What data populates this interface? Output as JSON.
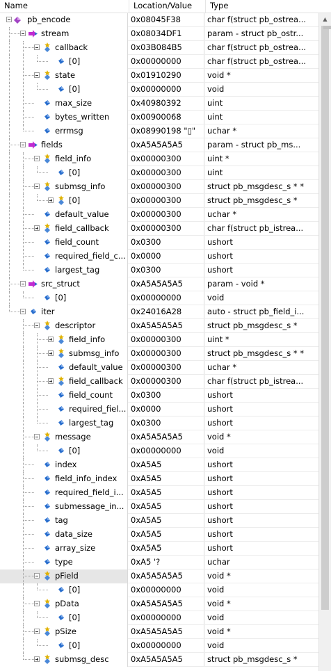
{
  "header": {
    "name": "Name",
    "location": "Location/Value",
    "type": "Type"
  },
  "rows": [
    {
      "d": 0,
      "icon": "function-icon",
      "tg": "minus",
      "name": "pb_encode",
      "value": "0x08045F38",
      "type": "char f(struct pb_ostrea..."
    },
    {
      "d": 1,
      "icon": "param-icon",
      "tg": "minus",
      "name": "stream",
      "value": "0x08034DF1",
      "type": "param - struct pb_ostr..."
    },
    {
      "d": 2,
      "icon": "pointer-icon",
      "tg": "minus",
      "name": "callback",
      "value": "0x03B084B5",
      "type": "char f(struct pb_ostrea..."
    },
    {
      "d": 3,
      "icon": "variable-icon",
      "name": "[0]",
      "value": "0x00000000",
      "type": "char f(struct pb_ostrea..."
    },
    {
      "d": 2,
      "icon": "pointer-icon",
      "tg": "minus",
      "name": "state",
      "value": "0x01910290",
      "type": "void *"
    },
    {
      "d": 3,
      "icon": "variable-icon",
      "name": "[0]",
      "value": "0x00000000",
      "type": "void"
    },
    {
      "d": 2,
      "icon": "variable-icon",
      "name": "max_size",
      "value": "0x40980392",
      "type": "uint"
    },
    {
      "d": 2,
      "icon": "variable-icon",
      "name": "bytes_written",
      "value": "0x00900068",
      "type": "uint"
    },
    {
      "d": 2,
      "icon": "variable-icon",
      "name": "errmsg",
      "value": "0x08990198 \"▯\"",
      "type": "uchar *"
    },
    {
      "d": 1,
      "icon": "param-icon",
      "tg": "minus",
      "name": "fields",
      "value": "0xA5A5A5A5",
      "type": "param - struct pb_ms..."
    },
    {
      "d": 2,
      "icon": "pointer-icon",
      "tg": "minus",
      "name": "field_info",
      "value": "0x00000300",
      "type": "uint *"
    },
    {
      "d": 3,
      "icon": "variable-icon",
      "name": "[0]",
      "value": "0x00000300",
      "type": "uint"
    },
    {
      "d": 2,
      "icon": "pointer-icon",
      "tg": "minus",
      "name": "submsg_info",
      "value": "0x00000300",
      "type": "struct pb_msgdesc_s * *"
    },
    {
      "d": 3,
      "icon": "pointer-icon",
      "tg": "plus",
      "name": "[0]",
      "value": "0x00000300",
      "type": "struct pb_msgdesc_s *"
    },
    {
      "d": 2,
      "icon": "variable-icon",
      "name": "default_value",
      "value": "0x00000300",
      "type": "uchar *"
    },
    {
      "d": 2,
      "icon": "pointer-icon",
      "tg": "plus",
      "name": "field_callback",
      "value": "0x00000300",
      "type": "char f(struct pb_istrea..."
    },
    {
      "d": 2,
      "icon": "variable-icon",
      "name": "field_count",
      "value": "0x0300",
      "type": "ushort"
    },
    {
      "d": 2,
      "icon": "variable-icon",
      "name": "required_field_c...",
      "value": "0x0000",
      "type": "ushort"
    },
    {
      "d": 2,
      "icon": "variable-icon",
      "name": "largest_tag",
      "value": "0x0300",
      "type": "ushort"
    },
    {
      "d": 1,
      "icon": "param-icon",
      "tg": "minus",
      "name": "src_struct",
      "value": "0xA5A5A5A5",
      "type": "param - void *"
    },
    {
      "d": 2,
      "icon": "variable-icon",
      "name": "[0]",
      "value": "0x00000000",
      "type": "void"
    },
    {
      "d": 1,
      "icon": "variable-icon",
      "tg": "minus",
      "name": "iter",
      "value": "0x24016A28",
      "type": "auto - struct pb_field_i..."
    },
    {
      "d": 2,
      "icon": "pointer-icon",
      "tg": "minus",
      "name": "descriptor",
      "value": "0xA5A5A5A5",
      "type": "struct pb_msgdesc_s *"
    },
    {
      "d": 3,
      "icon": "pointer-icon",
      "tg": "plus",
      "name": "field_info",
      "value": "0x00000300",
      "type": "uint *"
    },
    {
      "d": 3,
      "icon": "pointer-icon",
      "tg": "plus",
      "name": "submsg_info",
      "value": "0x00000300",
      "type": "struct pb_msgdesc_s * *"
    },
    {
      "d": 3,
      "icon": "variable-icon",
      "name": "default_value",
      "value": "0x00000300",
      "type": "uchar *"
    },
    {
      "d": 3,
      "icon": "pointer-icon",
      "tg": "plus",
      "name": "field_callback",
      "value": "0x00000300",
      "type": "char f(struct pb_istrea..."
    },
    {
      "d": 3,
      "icon": "variable-icon",
      "name": "field_count",
      "value": "0x0300",
      "type": "ushort"
    },
    {
      "d": 3,
      "icon": "variable-icon",
      "name": "required_fiel...",
      "value": "0x0000",
      "type": "ushort"
    },
    {
      "d": 3,
      "icon": "variable-icon",
      "name": "largest_tag",
      "value": "0x0300",
      "type": "ushort"
    },
    {
      "d": 2,
      "icon": "pointer-icon",
      "tg": "minus",
      "name": "message",
      "value": "0xA5A5A5A5",
      "type": "void *"
    },
    {
      "d": 3,
      "icon": "variable-icon",
      "name": "[0]",
      "value": "0x00000000",
      "type": "void"
    },
    {
      "d": 2,
      "icon": "variable-icon",
      "name": "index",
      "value": "0xA5A5",
      "type": "ushort"
    },
    {
      "d": 2,
      "icon": "variable-icon",
      "name": "field_info_index",
      "value": "0xA5A5",
      "type": "ushort"
    },
    {
      "d": 2,
      "icon": "variable-icon",
      "name": "required_field_i...",
      "value": "0xA5A5",
      "type": "ushort"
    },
    {
      "d": 2,
      "icon": "variable-icon",
      "name": "submessage_in...",
      "value": "0xA5A5",
      "type": "ushort"
    },
    {
      "d": 2,
      "icon": "variable-icon",
      "name": "tag",
      "value": "0xA5A5",
      "type": "ushort"
    },
    {
      "d": 2,
      "icon": "variable-icon",
      "name": "data_size",
      "value": "0xA5A5",
      "type": "ushort"
    },
    {
      "d": 2,
      "icon": "variable-icon",
      "name": "array_size",
      "value": "0xA5A5",
      "type": "ushort"
    },
    {
      "d": 2,
      "icon": "variable-icon",
      "name": "type",
      "value": "0xA5 '?",
      "type": "uchar"
    },
    {
      "d": 2,
      "icon": "pointer-icon",
      "tg": "minus",
      "name": "pField",
      "value": "0xA5A5A5A5",
      "type": "void *",
      "sel": true
    },
    {
      "d": 3,
      "icon": "variable-icon",
      "name": "[0]",
      "value": "0x00000000",
      "type": "void"
    },
    {
      "d": 2,
      "icon": "pointer-icon",
      "tg": "minus",
      "name": "pData",
      "value": "0xA5A5A5A5",
      "type": "void *"
    },
    {
      "d": 3,
      "icon": "variable-icon",
      "name": "[0]",
      "value": "0x00000000",
      "type": "void"
    },
    {
      "d": 2,
      "icon": "pointer-icon",
      "tg": "minus",
      "name": "pSize",
      "value": "0xA5A5A5A5",
      "type": "void *"
    },
    {
      "d": 3,
      "icon": "variable-icon",
      "name": "[0]",
      "value": "0x00000000",
      "type": "void"
    },
    {
      "d": 2,
      "icon": "pointer-icon",
      "tg": "plus",
      "name": "submsg_desc",
      "value": "0xA5A5A5A5",
      "type": "struct pb_msgdesc_s *"
    }
  ],
  "colors": {
    "function": "#a244c4",
    "param_arrow": "#c02ad0",
    "variable": "#2a6fce",
    "pointer_star": "#e0b200",
    "pointer_body": "#4a88d8"
  },
  "scrollbar": {
    "up_arrow": "▲"
  }
}
